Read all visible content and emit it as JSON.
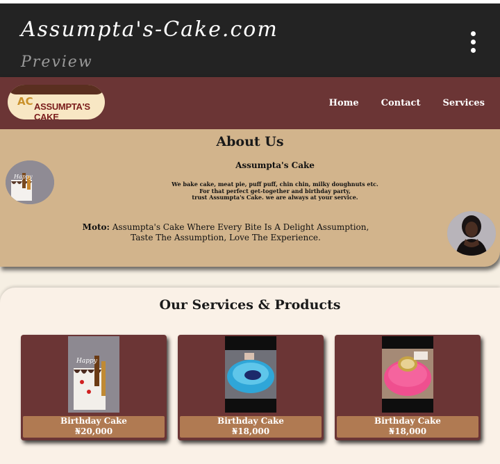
{
  "appbar": {
    "title": "Assumpta's-Cake.com",
    "subtitle": "Preview"
  },
  "nav": {
    "logo_text": "ASSUMPTA'S CAKE",
    "logo_mark": "AC",
    "links": [
      "Home",
      "Contact",
      "Services"
    ]
  },
  "about": {
    "heading": "About Us",
    "name": "Assumpta's Cake",
    "desc_line1": "We bake cake, meat pie, puff puff, chin chin, milky doughnuts etc.",
    "desc_line2": "For that perfect get-together and birthday party,",
    "desc_line3": "trust Assumpta's Cake. we are always at your service.",
    "motto_label": "Moto:",
    "motto_text": "Assumpta's Cake Where Every Bite Is A Delight Assumption, Taste The Assumption, Love The Experience."
  },
  "services": {
    "heading": "Our Services & Products",
    "products": [
      {
        "name": "Birthday Cake",
        "price": "₦20,000"
      },
      {
        "name": "Birthday Cake",
        "price": "₦18,000"
      },
      {
        "name": "Birthday Cake",
        "price": "₦18,000"
      }
    ]
  },
  "colors": {
    "appbar": "#232323",
    "nav": "#6b3535",
    "about_bg": "#d2b48c",
    "caption_bg": "#b07a52"
  }
}
